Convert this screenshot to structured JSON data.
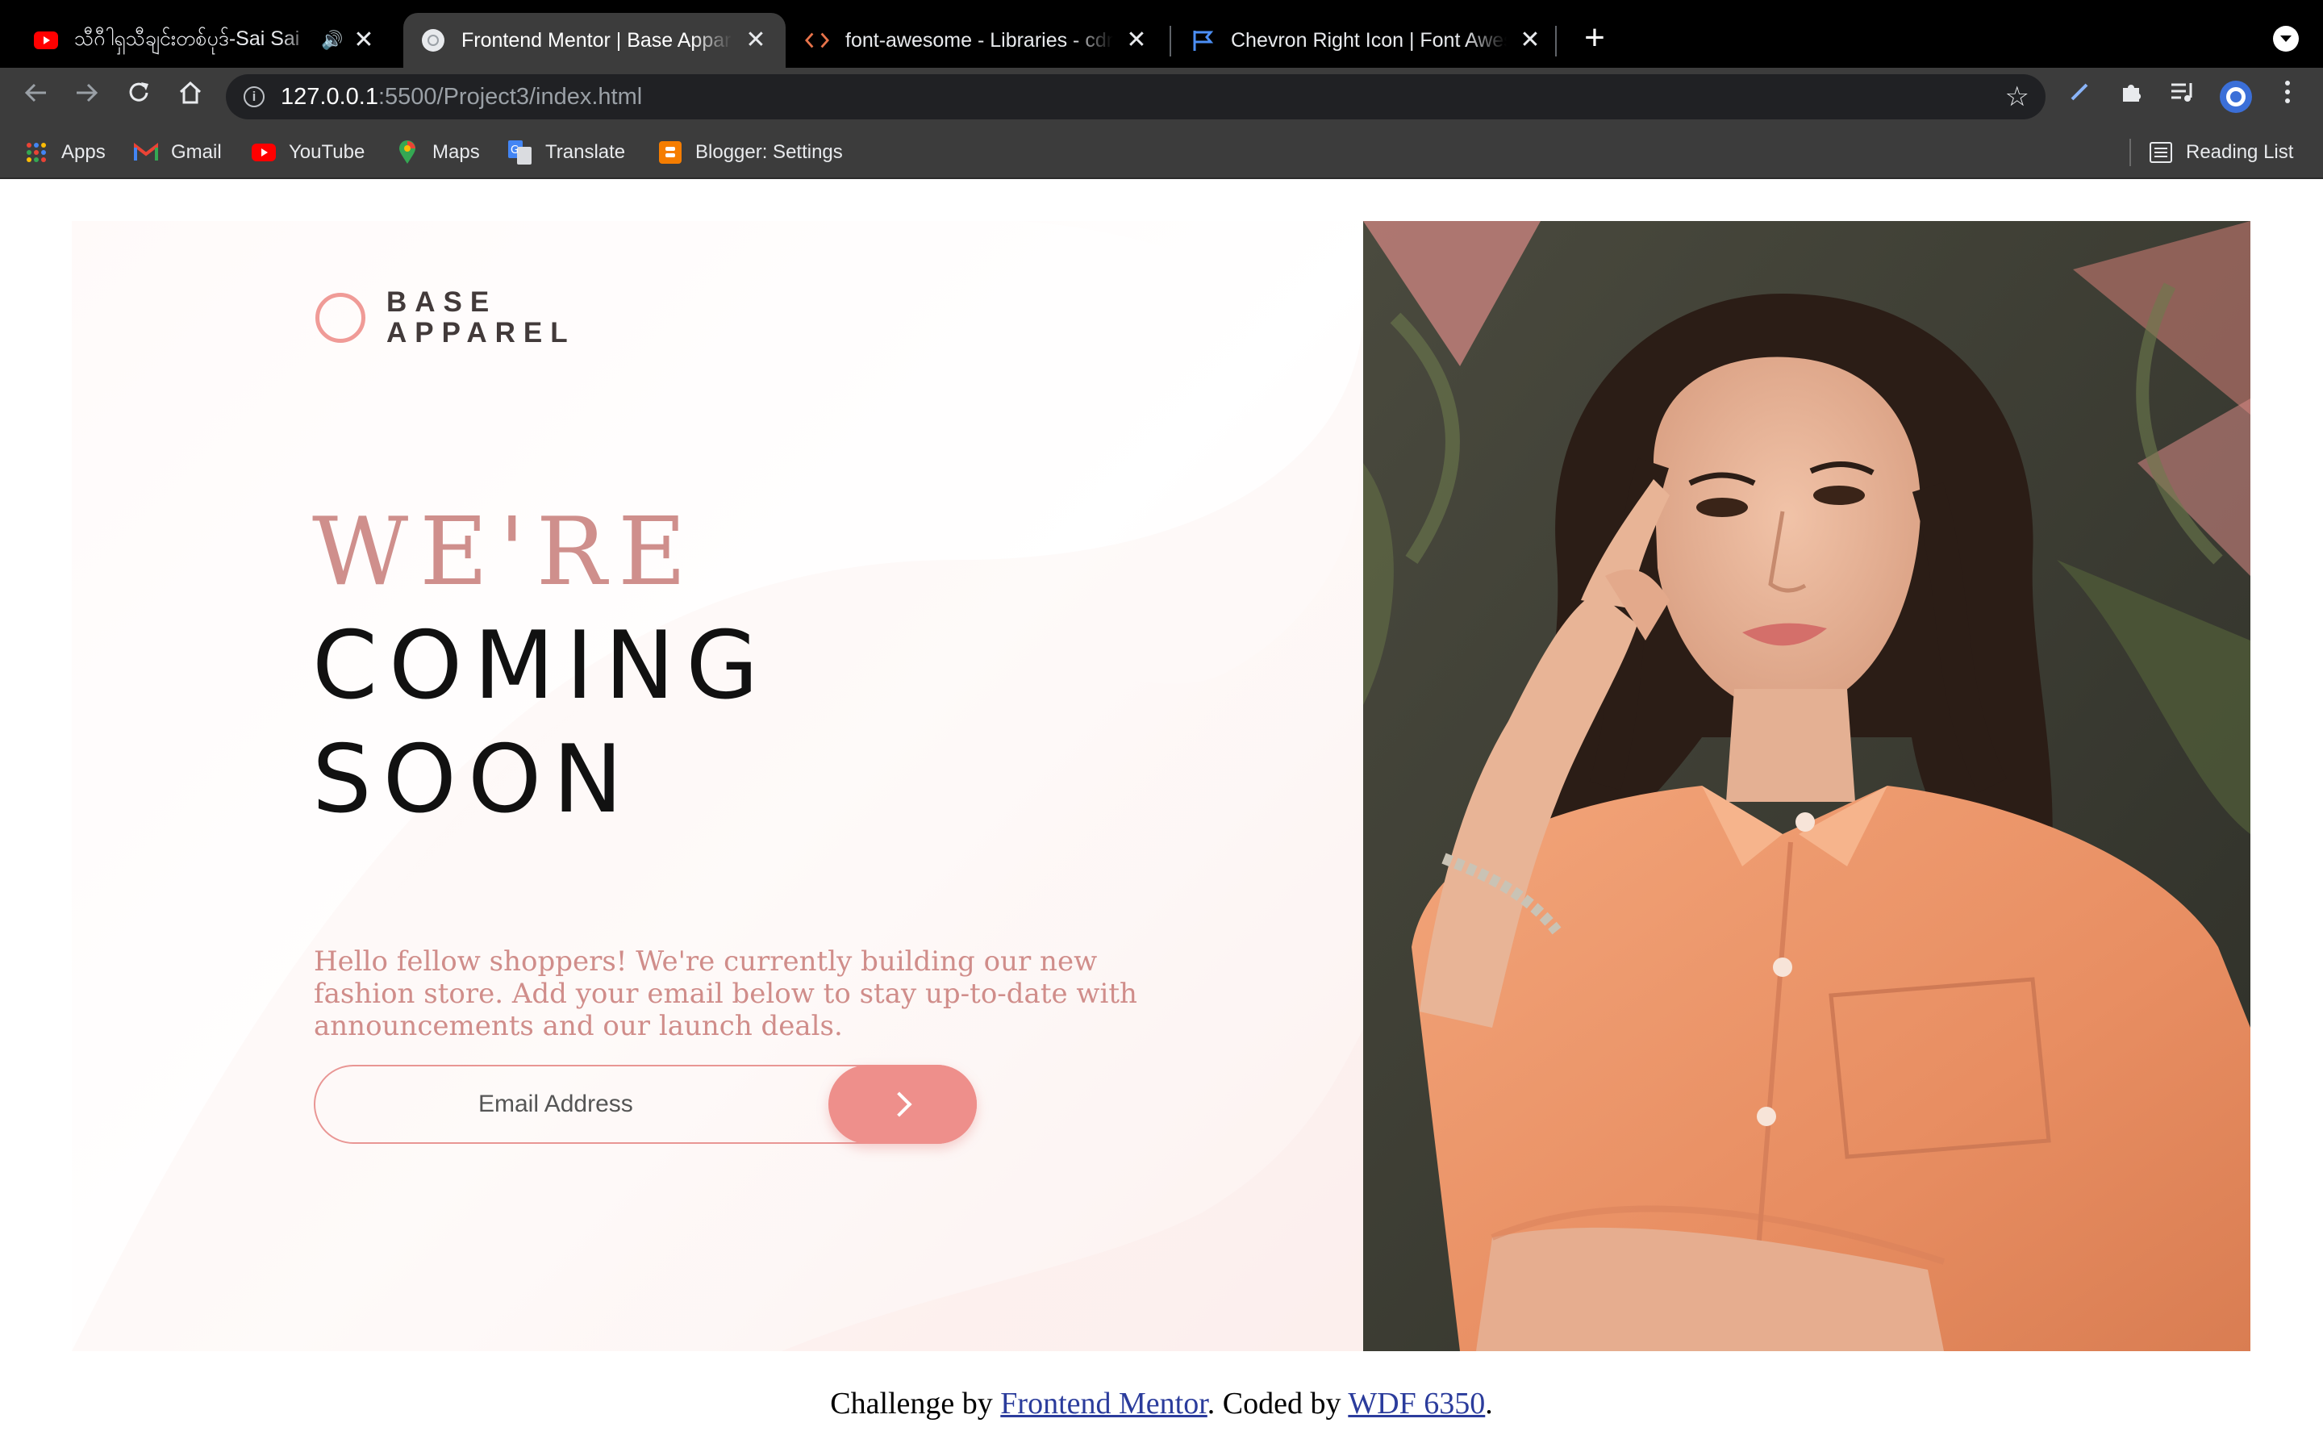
{
  "browser": {
    "tabs": [
      {
        "title": "သီဂီါရှသီချင်းတစ်ပုဒ်-Sai Sai",
        "favicon": "youtube-icon",
        "audio": true
      },
      {
        "title": "Frontend Mentor | Base Apparel",
        "favicon": "frontend-mentor-icon",
        "active": true
      },
      {
        "title": "font-awesome - Libraries - cdnjs",
        "favicon": "code-icon"
      },
      {
        "title": "Chevron Right Icon | Font Awesome",
        "favicon": "flag-icon"
      }
    ],
    "url_host": "127.0.0.1",
    "url_path": ":5500/Project3/index.html",
    "bookmarks": [
      {
        "label": "Apps",
        "icon": "apps-grid-icon"
      },
      {
        "label": "Gmail",
        "icon": "gmail-icon"
      },
      {
        "label": "YouTube",
        "icon": "youtube-icon"
      },
      {
        "label": "Maps",
        "icon": "maps-icon"
      },
      {
        "label": "Translate",
        "icon": "translate-icon"
      },
      {
        "label": "Blogger: Settings",
        "icon": "blogger-icon"
      }
    ],
    "reading_list": "Reading List"
  },
  "page": {
    "logo_line1": "BASE",
    "logo_line2": "APPAREL",
    "heading_light": "WE'RE",
    "heading_dark_1": "COMING",
    "heading_dark_2": "SOON",
    "description": "Hello fellow shoppers! We're currently building our new fashion store. Add your email below to stay up-to-date with announcements and our launch deals.",
    "email_placeholder": "Email Address",
    "submit_icon": "chevron-right-icon",
    "colors": {
      "accent": "#ee8f8b",
      "heading_light": "#cf8f8c",
      "text_pink": "#d08d8a",
      "dark": "#111111"
    }
  },
  "footer": {
    "prefix": "Challenge by ",
    "link1": "Frontend Mentor",
    "middle": ". Coded by ",
    "link2": "WDF 6350",
    "suffix": "."
  }
}
